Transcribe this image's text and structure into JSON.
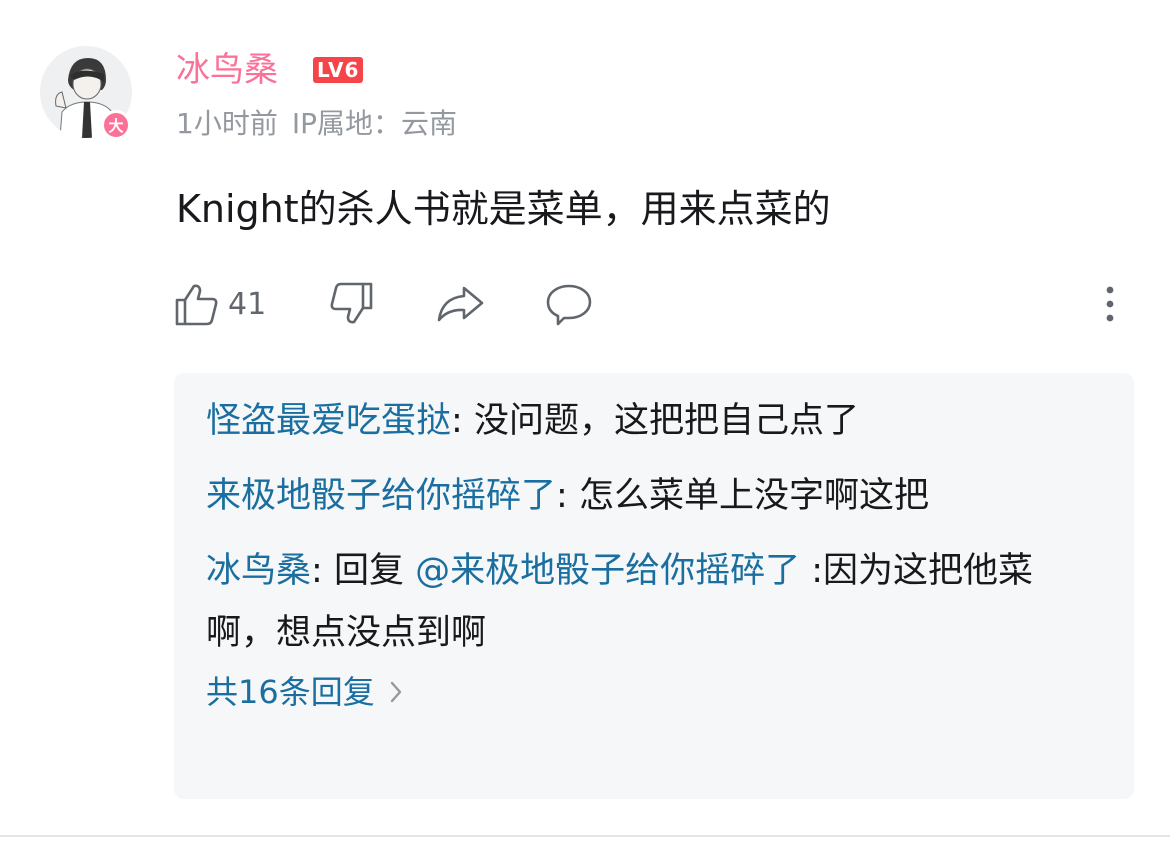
{
  "comment": {
    "username": "冰鸟桑",
    "level_badge": "LV6",
    "vip_badge": "大",
    "time": "1小时前",
    "ip_location": "IP属地：云南",
    "text": "Knight的杀人书就是菜单，用来点菜的",
    "like_count": "41",
    "icons": [
      "thumb-up-icon",
      "thumb-down-icon",
      "share-icon",
      "reply-icon",
      "more-icon"
    ],
    "colors": {
      "username": "#fb7299",
      "level_badge": "#f6454a",
      "reply_name": "#1a6fa0"
    }
  },
  "replies": {
    "items": [
      {
        "name": "怪盗最爱吃蛋挞",
        "separator": ": ",
        "text": "没问题，这把把自己点了"
      },
      {
        "name": "来极地骰子给你摇碎了",
        "separator": ": ",
        "text": "怎么菜单上没字啊这把"
      },
      {
        "name": "冰鸟桑",
        "separator": ": ",
        "prefix": "回复 ",
        "mention": "@来极地骰子给你摇碎了",
        "text": " :因为这把他菜啊，想点没点到啊"
      }
    ],
    "total_label": "共16条回复"
  }
}
